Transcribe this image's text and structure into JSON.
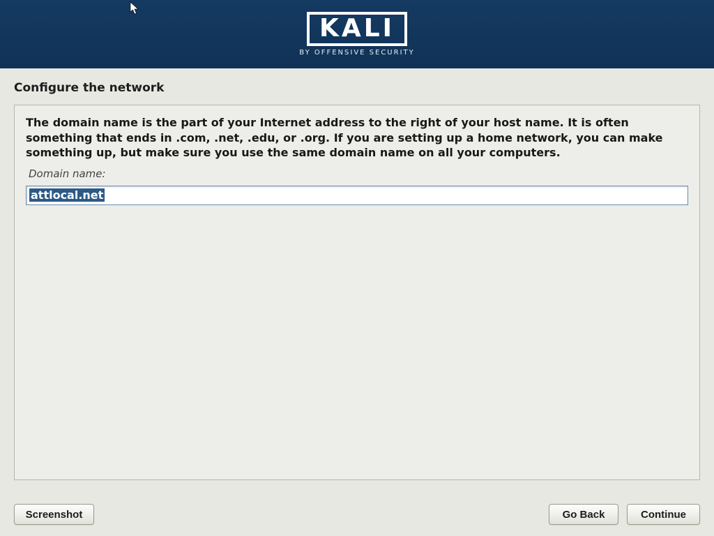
{
  "header": {
    "logo_main": "KALI",
    "logo_sub": "BY OFFENSIVE SECURITY"
  },
  "page": {
    "title": "Configure the network",
    "description": "The domain name is the part of your Internet address to the right of your host name.  It is often something that ends in .com, .net, .edu, or .org.  If you are setting up a home network, you can make something up, but make sure you use the same domain name on all your computers.",
    "field_label": "Domain name:",
    "field_value": "attlocal.net"
  },
  "buttons": {
    "screenshot": "Screenshot",
    "go_back": "Go Back",
    "continue": "Continue"
  }
}
